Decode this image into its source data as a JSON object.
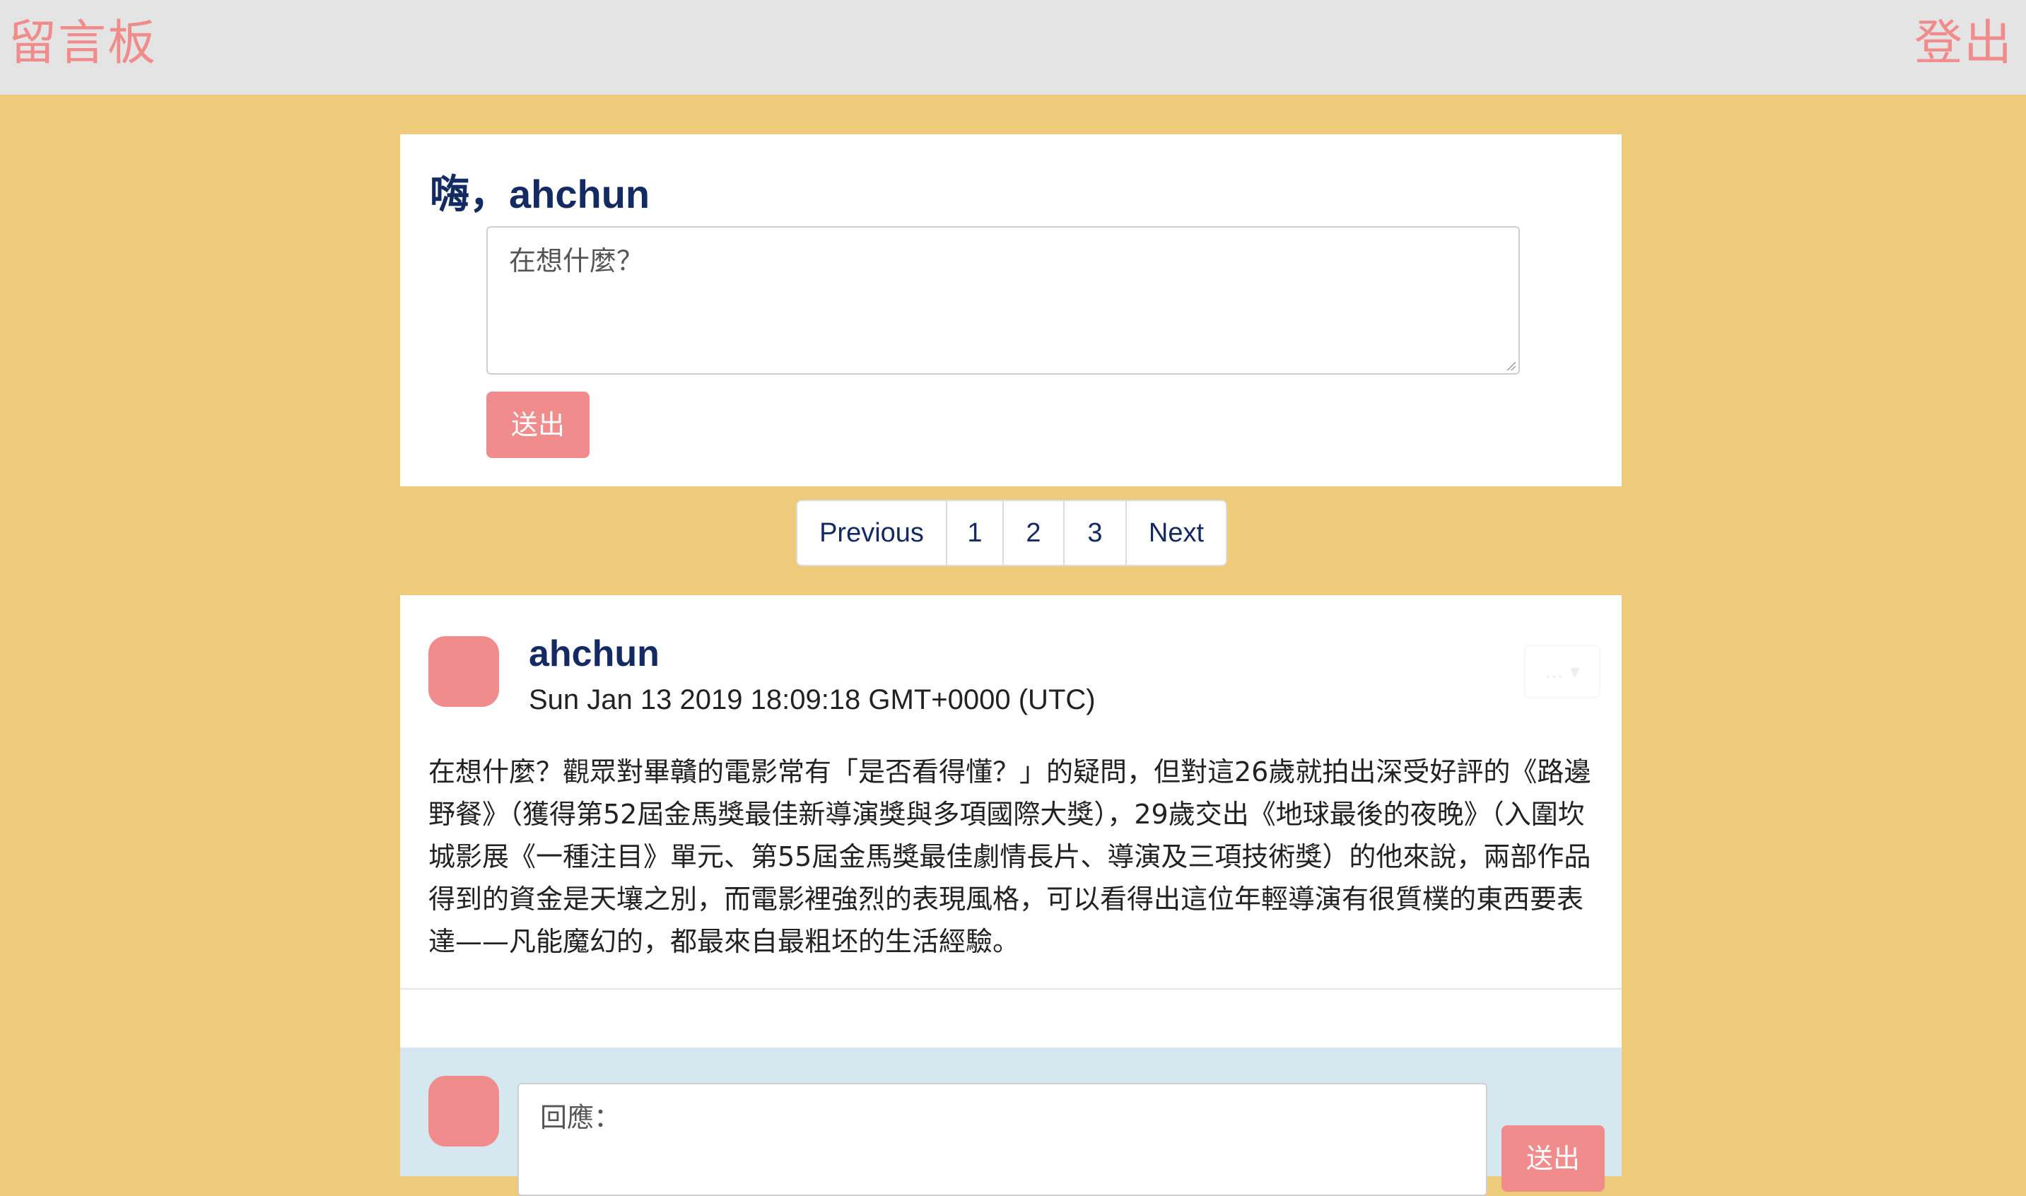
{
  "header": {
    "brand": "留言板",
    "logout": "登出"
  },
  "compose": {
    "greeting": "嗨，ahchun",
    "placeholder": "在想什麼？",
    "submit": "送出"
  },
  "pagination": {
    "previous": "Previous",
    "pages": [
      "1",
      "2",
      "3"
    ],
    "next": "Next"
  },
  "post": {
    "author": "ahchun",
    "time": "Sun Jan 13 2019 18:09:18 GMT+0000 (UTC)",
    "menu_label": "... ▾",
    "content": "在想什麼？觀眾對畢贛的電影常有「是否看得懂？」的疑問，但對這26歲就拍出深受好評的《路邊野餐》（獲得第52屆金馬獎最佳新導演獎與多項國際大獎），29歲交出《地球最後的夜晚》（入圍坎城影展《一種注目》單元、第55屆金馬獎最佳劇情長片、導演及三項技術獎）的他來說，兩部作品得到的資金是天壤之別，而電影裡強烈的表現風格，可以看得出這位年輕導演有很質樸的東西要表達——凡能魔幻的，都最來自最粗坯的生活經驗。",
    "reply": {
      "placeholder": "回應：",
      "submit": "送出"
    }
  },
  "colors": {
    "background": "#edcb7b",
    "topbar": "#e4e4e4",
    "accent": "#f08c8c",
    "heading": "#142a63",
    "reply_bg": "#d6e8ef"
  }
}
